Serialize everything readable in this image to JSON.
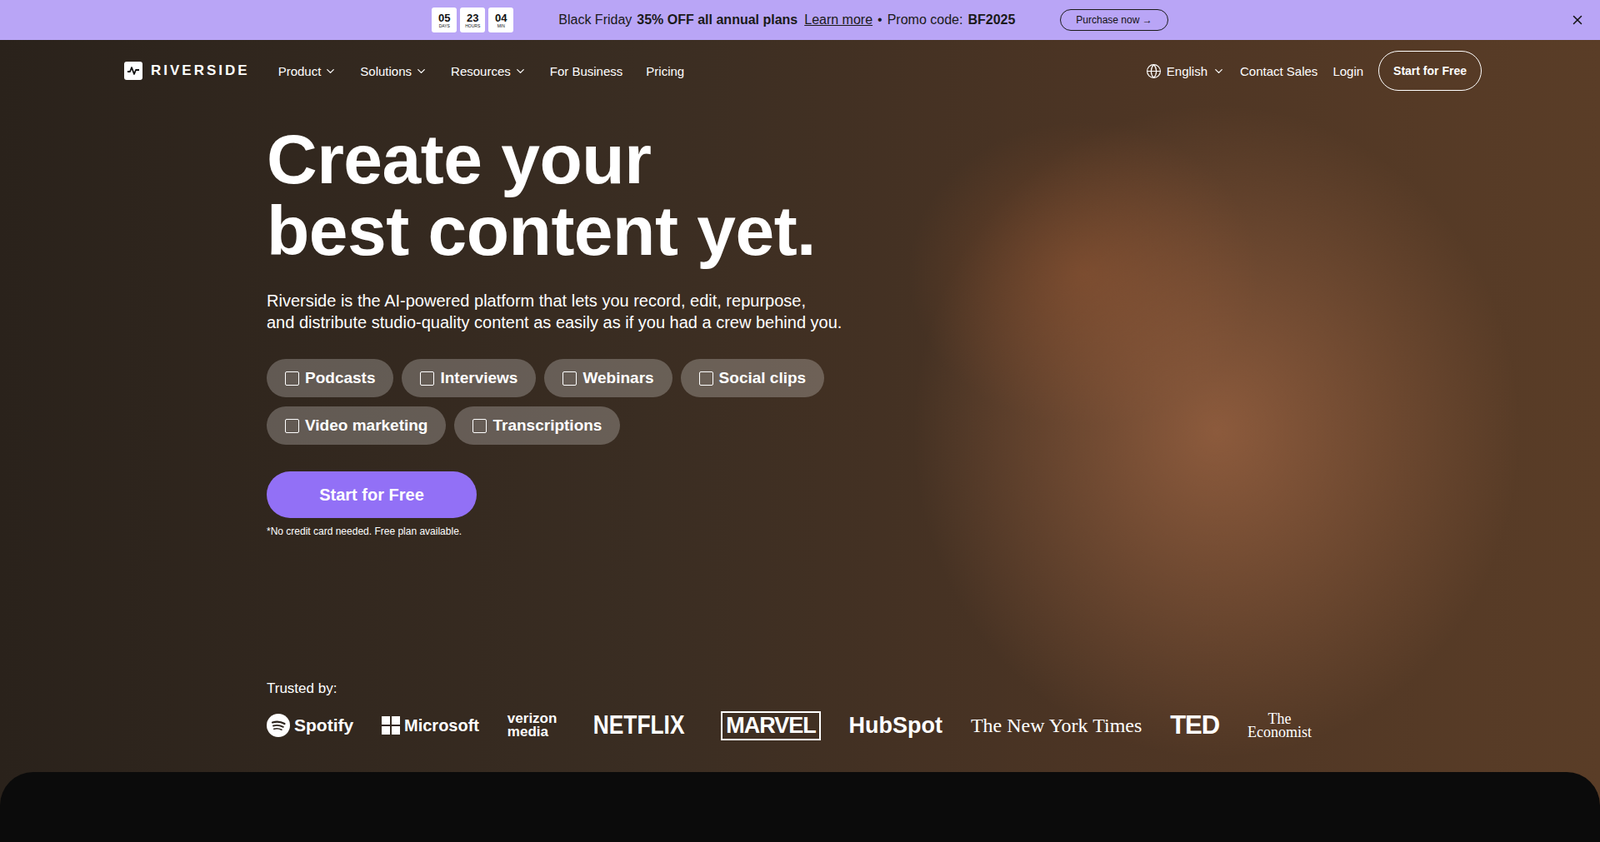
{
  "banner": {
    "countdown": [
      {
        "value": "05",
        "unit": "DAYS"
      },
      {
        "value": "23",
        "unit": "HOURS"
      },
      {
        "value": "04",
        "unit": "MIN"
      }
    ],
    "lead": "Black Friday",
    "offer": "35% OFF all annual plans",
    "link": "Learn more",
    "separator": "•",
    "promo_label": "Promo code:",
    "promo_code": "BF2025",
    "button": {
      "label": "Purchase now",
      "arrow": "→"
    }
  },
  "nav": {
    "logo": "RIVERSIDE",
    "items": [
      {
        "label": "Product",
        "dropdown": true
      },
      {
        "label": "Solutions",
        "dropdown": true
      },
      {
        "label": "Resources",
        "dropdown": true
      },
      {
        "label": "For Business",
        "dropdown": false
      },
      {
        "label": "Pricing",
        "dropdown": false
      }
    ],
    "language": "English",
    "contact": "Contact Sales",
    "login": "Login",
    "cta": "Start for Free"
  },
  "hero": {
    "headline": [
      "Create your",
      "best content yet."
    ],
    "subtitle": [
      "Riverside is the AI-powered platform that lets you record, edit, repurpose,",
      "and distribute studio-quality content as easily as if you had a crew behind you."
    ],
    "chip_rows": [
      [
        {
          "label": "Podcasts",
          "checked": false
        },
        {
          "label": "Interviews",
          "checked": false
        },
        {
          "label": "Webinars",
          "checked": false
        },
        {
          "label": "Social clips",
          "checked": false
        }
      ],
      [
        {
          "label": "Video marketing",
          "checked": false
        },
        {
          "label": "Transcriptions",
          "checked": false
        }
      ]
    ],
    "cta": "Start for Free",
    "note": "*No credit card needed. Free plan available."
  },
  "trusted": {
    "label": "Trusted by:",
    "logos": [
      {
        "kind": "spotify",
        "lines": [
          "Spotify"
        ]
      },
      {
        "kind": "microsoft",
        "lines": [
          "Microsoft"
        ]
      },
      {
        "kind": "verizon",
        "lines": [
          "verizon",
          "media"
        ]
      },
      {
        "kind": "netflix",
        "lines": [
          "NETFLIX"
        ]
      },
      {
        "kind": "marvel",
        "lines": [
          "MARVEL"
        ]
      },
      {
        "kind": "hubspot",
        "lines": [
          "HubSpot"
        ]
      },
      {
        "kind": "nyt",
        "lines": [
          "The New York Times"
        ]
      },
      {
        "kind": "ted",
        "lines": [
          "TED"
        ]
      },
      {
        "kind": "economist",
        "lines": [
          "The",
          "Economist"
        ]
      }
    ]
  }
}
